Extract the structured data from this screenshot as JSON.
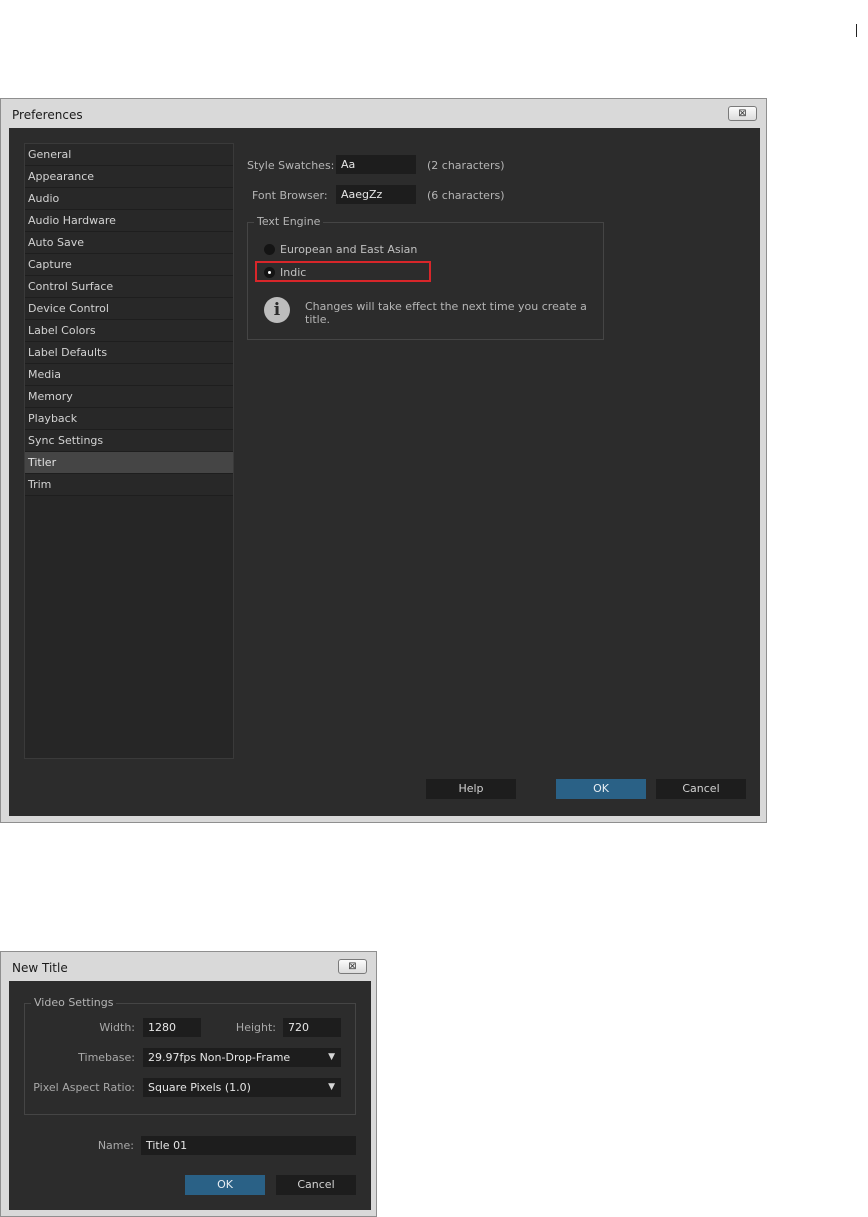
{
  "preferences": {
    "title": "Preferences",
    "close_glyph": "⊠",
    "sidebar": {
      "items": [
        {
          "label": "General"
        },
        {
          "label": "Appearance"
        },
        {
          "label": "Audio"
        },
        {
          "label": "Audio Hardware"
        },
        {
          "label": "Auto Save"
        },
        {
          "label": "Capture"
        },
        {
          "label": "Control Surface"
        },
        {
          "label": "Device Control"
        },
        {
          "label": "Label Colors"
        },
        {
          "label": "Label Defaults"
        },
        {
          "label": "Media"
        },
        {
          "label": "Memory"
        },
        {
          "label": "Playback"
        },
        {
          "label": "Sync Settings"
        },
        {
          "label": "Titler"
        },
        {
          "label": "Trim"
        }
      ],
      "selected": "Titler"
    },
    "style_swatches": {
      "label": "Style Swatches:",
      "value": "Aa",
      "hint": "(2 characters)"
    },
    "font_browser": {
      "label": "Font Browser:",
      "value": "AaegZz",
      "hint": "(6 characters)"
    },
    "text_engine": {
      "legend": "Text Engine",
      "options": [
        {
          "label": "European and East Asian",
          "checked": false
        },
        {
          "label": "Indic",
          "checked": true
        }
      ],
      "info_icon": "info-icon",
      "info_glyph": "i",
      "info_text": "Changes will take effect the next time you create a title."
    },
    "buttons": {
      "help": "Help",
      "ok": "OK",
      "cancel": "Cancel"
    },
    "colors": {
      "accent": "#2a6186",
      "highlight": "#d8262a",
      "background": "#2c2c2c"
    }
  },
  "new_title": {
    "title": "New Title",
    "close_glyph": "⊠",
    "video_settings": {
      "legend": "Video Settings",
      "width_label": "Width:",
      "width_value": "1280",
      "height_label": "Height:",
      "height_value": "720",
      "timebase_label": "Timebase:",
      "timebase_value": "29.97fps Non-Drop-Frame",
      "par_label": "Pixel Aspect Ratio:",
      "par_value": "Square Pixels (1.0)",
      "dropdown_glyph": "▼"
    },
    "name_label": "Name:",
    "name_value": "Title 01",
    "buttons": {
      "ok": "OK",
      "cancel": "Cancel"
    }
  }
}
